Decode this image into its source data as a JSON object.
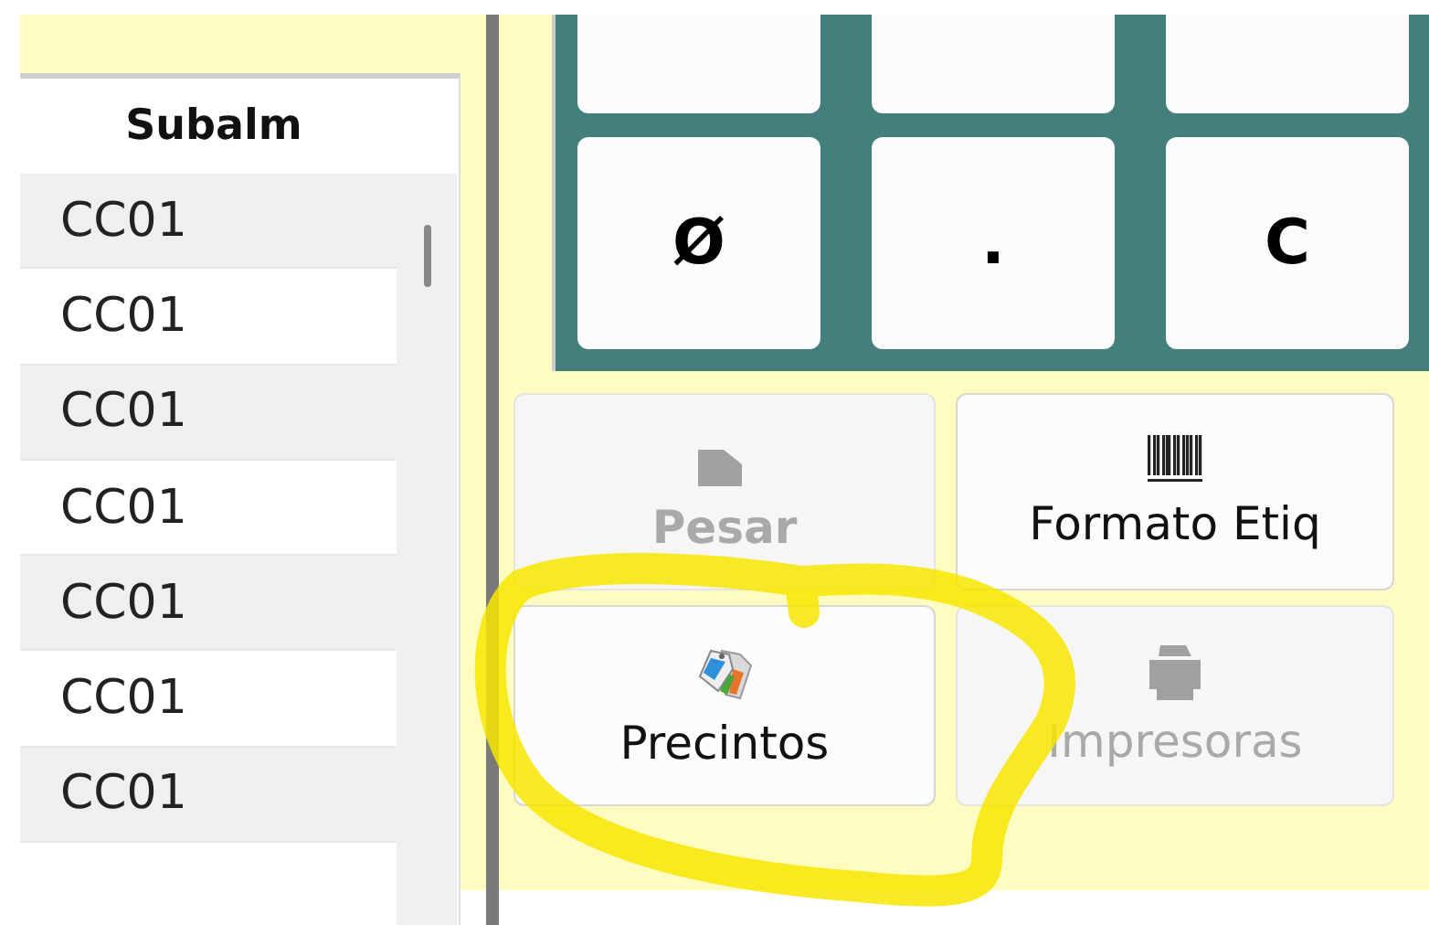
{
  "table": {
    "columns": [
      "Subalm"
    ],
    "rows": [
      {
        "subalm": "CC01"
      },
      {
        "subalm": "CC01"
      },
      {
        "subalm": "CC01"
      },
      {
        "subalm": "CC01"
      },
      {
        "subalm": "CC01"
      },
      {
        "subalm": "CC01"
      },
      {
        "subalm": "CC01"
      }
    ]
  },
  "keypad": {
    "keys": [
      {
        "label": "Ø"
      },
      {
        "label": "."
      },
      {
        "label": "C"
      }
    ]
  },
  "actions": [
    {
      "label": "Pesar",
      "disabled": true
    },
    {
      "label": "Formato Etiq",
      "disabled": false
    },
    {
      "label": "Precintos",
      "disabled": false
    },
    {
      "label": "Impresoras",
      "disabled": true
    }
  ],
  "annotation": {
    "kind": "circle"
  }
}
